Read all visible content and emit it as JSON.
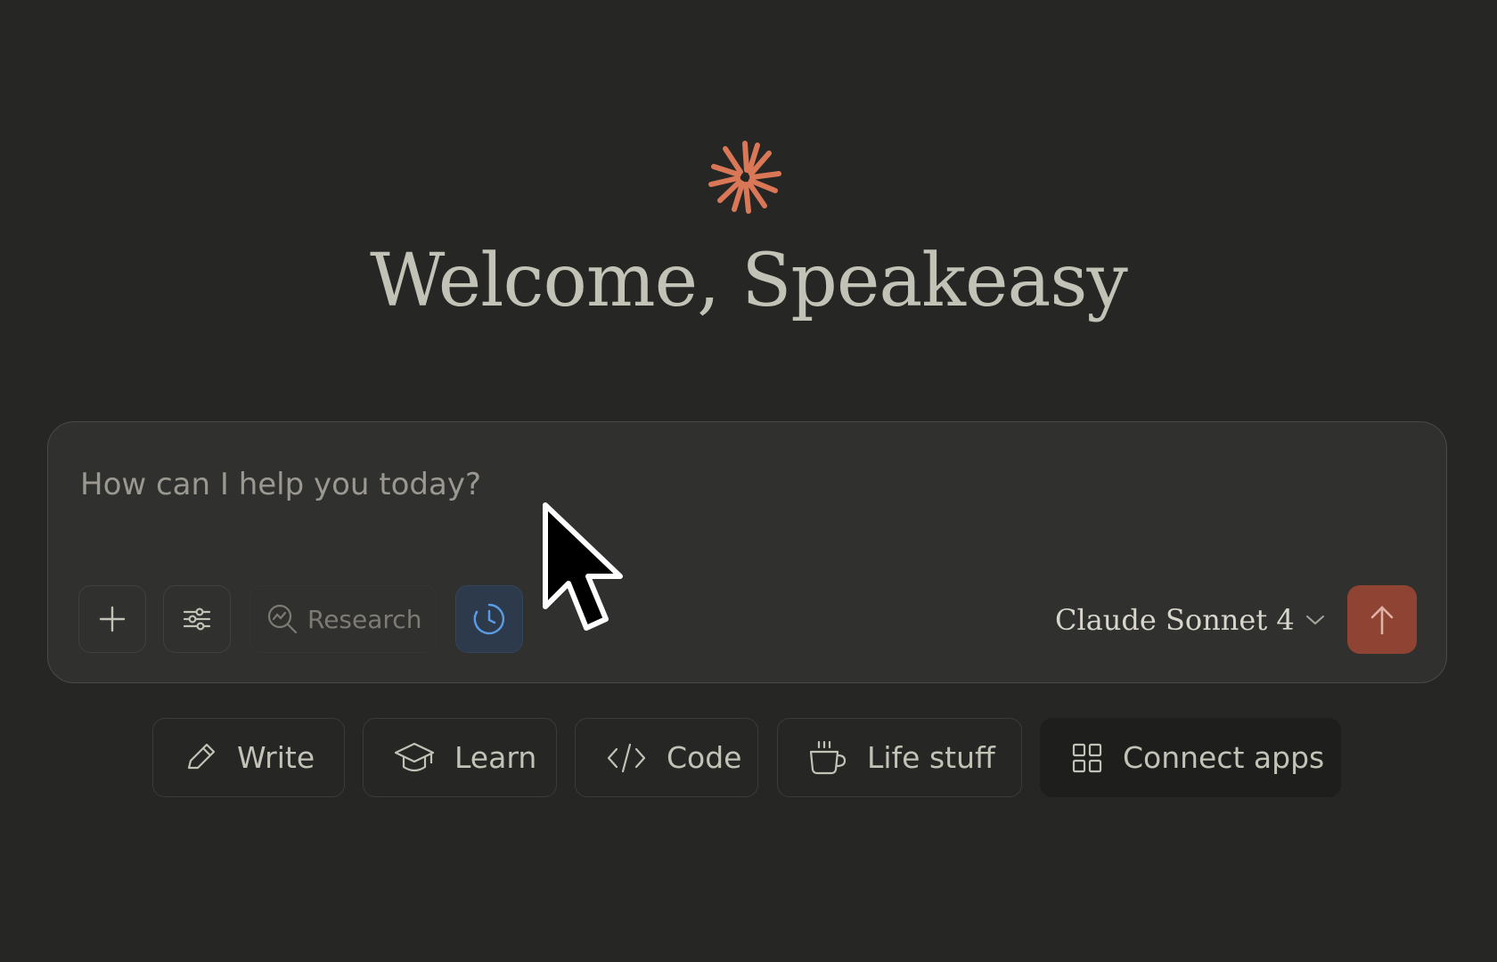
{
  "greeting": "Welcome, Speakeasy",
  "composer": {
    "placeholder": "How can I help you today?",
    "research_label": "Research",
    "model_label": "Claude Sonnet 4"
  },
  "chips": [
    {
      "label": "Write",
      "icon": "pencil-icon"
    },
    {
      "label": "Learn",
      "icon": "graduation-cap-icon"
    },
    {
      "label": "Code",
      "icon": "code-icon"
    },
    {
      "label": "Life stuff",
      "icon": "coffee-cup-icon"
    },
    {
      "label": "Connect apps",
      "icon": "grid-icon"
    }
  ],
  "colors": {
    "background": "#262624",
    "accent": "#d97757",
    "send_button": "#8e4333",
    "history_active": "#2c3a4c"
  }
}
